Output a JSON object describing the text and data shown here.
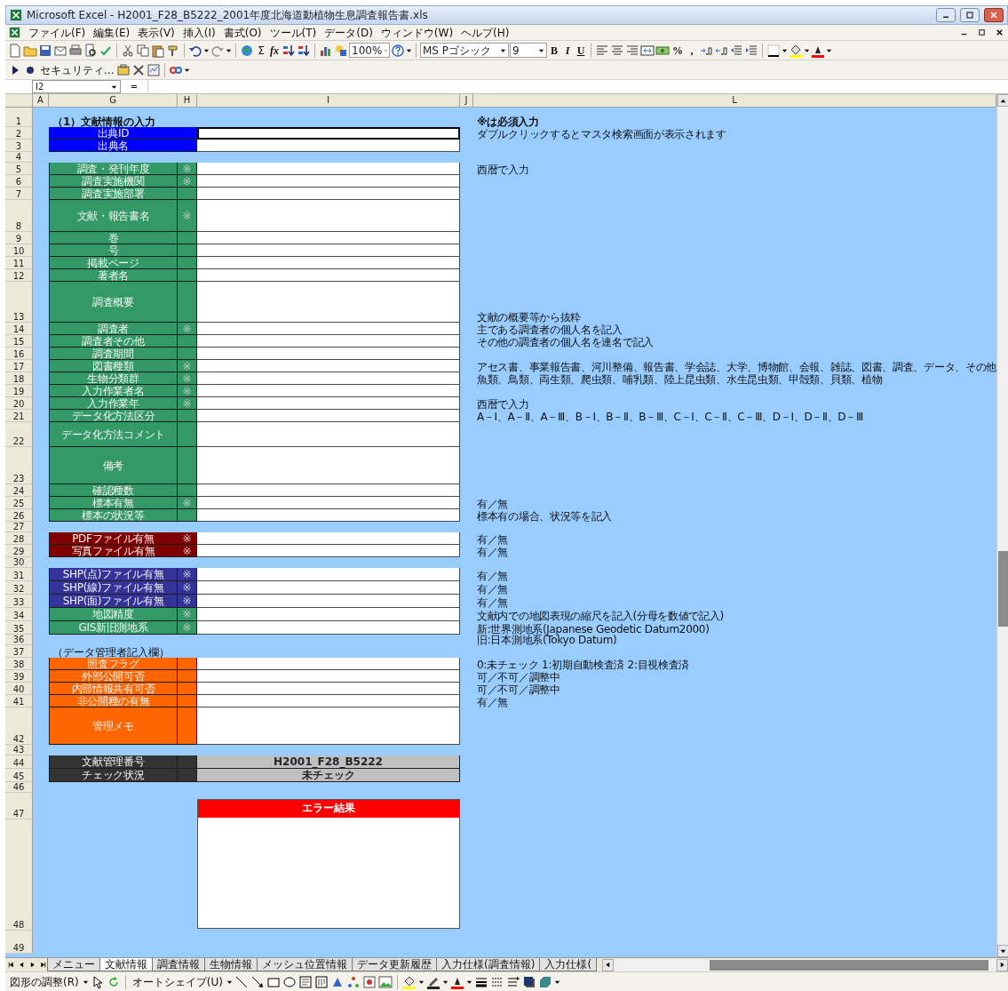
{
  "window": {
    "title": "Microsoft Excel - H2001_F28_B5222_2001年度北海道動植物生息調査報告書.xls"
  },
  "menu_bar": [
    "ファイル(F)",
    "編集(E)",
    "表示(V)",
    "挿入(I)",
    "書式(O)",
    "ツール(T)",
    "データ(D)",
    "ウィンドウ(W)",
    "ヘルプ(H)"
  ],
  "toolbar": {
    "sum": "Σ",
    "function": "fx",
    "zoom": "100%",
    "font": "MS Pゴシック",
    "font_size": "9",
    "styles": [
      "B",
      "I",
      "U"
    ],
    "percent": "%",
    "comma": ","
  },
  "toolbar_2": {
    "security": "セキュリティ..."
  },
  "formula_bar": {
    "name_box": "I2",
    "equals": "="
  },
  "column_headers": [
    "A",
    "G",
    "H",
    "I",
    "J",
    "L"
  ],
  "sheet": {
    "rows": [
      {
        "number": "1",
        "kind": "heading",
        "text": "（1）文献情報の入力",
        "note": "※は必須入力"
      },
      {
        "number": "2",
        "kind": "field",
        "label": "出典ID",
        "color": "#0000ff",
        "selected": true,
        "note": "ダブルクリックするとマスタ検索画面が表示されます"
      },
      {
        "number": "3",
        "kind": "field",
        "label": "出典名",
        "color": "#0000ff",
        "selected": false
      },
      {
        "number": "4",
        "kind": "blank"
      },
      {
        "number": "5",
        "kind": "field",
        "label": "調査・発刊年度",
        "mark": "※",
        "color": "#339966",
        "selected": false,
        "note": "西暦で入力"
      },
      {
        "number": "6",
        "kind": "field",
        "label": "調査実施機関",
        "mark": "※",
        "color": "#339966",
        "selected": false
      },
      {
        "number": "7",
        "kind": "field",
        "label": "調査実施部署",
        "color": "#339966",
        "selected": false
      },
      {
        "number": "8",
        "kind": "field",
        "label": "文献・報告書名",
        "mark": "※",
        "color": "#339966",
        "selected": false
      },
      {
        "number": "9",
        "kind": "field",
        "label": "巻",
        "color": "#339966",
        "selected": false
      },
      {
        "number": "10",
        "kind": "field",
        "label": "号",
        "color": "#339966",
        "selected": false
      },
      {
        "number": "11",
        "kind": "field",
        "label": "掲載ページ",
        "color": "#339966",
        "selected": false
      },
      {
        "number": "12",
        "kind": "field",
        "label": "著者名",
        "color": "#339966",
        "selected": false
      },
      {
        "number": "13",
        "kind": "field",
        "label": "調査概要",
        "color": "#339966",
        "selected": false,
        "note": "文献の概要等から抜粋"
      },
      {
        "number": "14",
        "kind": "field",
        "label": "調査者",
        "mark": "※",
        "color": "#339966",
        "selected": false,
        "note": "主である調査者の個人名を記入"
      },
      {
        "number": "15",
        "kind": "field",
        "label": "調査者その他",
        "color": "#339966",
        "selected": false,
        "note": "その他の調査者の個人名を連名で記入"
      },
      {
        "number": "16",
        "kind": "field",
        "label": "調査期間",
        "color": "#339966",
        "selected": false
      },
      {
        "number": "17",
        "kind": "field",
        "label": "図書種類",
        "mark": "※",
        "color": "#339966",
        "selected": false,
        "note": "アセス書、事業報告書、河川整備、報告書、学会誌、大学、博物館、会報、雑誌、図書、調査、データ、その他"
      },
      {
        "number": "18",
        "kind": "field",
        "label": "生物分類群",
        "mark": "※",
        "color": "#339966",
        "selected": false,
        "note": "魚類、鳥類、両生類、爬虫類、哺乳類、陸上昆虫類、水生昆虫類、甲殻類、貝類、植物"
      },
      {
        "number": "19",
        "kind": "field",
        "label": "入力作業者名",
        "mark": "※",
        "color": "#339966",
        "selected": false
      },
      {
        "number": "20",
        "kind": "field",
        "label": "入力作業年",
        "mark": "※",
        "color": "#339966",
        "selected": false,
        "note": "西暦で入力"
      },
      {
        "number": "21",
        "kind": "field",
        "label": "データ化方法区分",
        "color": "#339966",
        "selected": false,
        "note": "A－Ⅰ、A－Ⅱ、A－Ⅲ、B－Ⅰ、B－Ⅱ、B－Ⅲ、C－Ⅰ、C－Ⅱ、C－Ⅲ、D－Ⅰ、D－Ⅱ、D－Ⅲ"
      },
      {
        "number": "22",
        "kind": "field",
        "label": "データ化方法コメント",
        "color": "#339966",
        "selected": false
      },
      {
        "number": "23",
        "kind": "field",
        "label": "備考",
        "color": "#339966",
        "selected": false
      },
      {
        "number": "24",
        "kind": "field",
        "label": "確認種数",
        "color": "#339966",
        "selected": false
      },
      {
        "number": "25",
        "kind": "field",
        "label": "標本有無",
        "mark": "※",
        "color": "#339966",
        "selected": false,
        "note": "有／無"
      },
      {
        "number": "26",
        "kind": "field",
        "label": "標本の状況等",
        "color": "#339966",
        "selected": false,
        "note": "標本有の場合、状況等を記入"
      },
      {
        "number": "27",
        "kind": "blank"
      },
      {
        "number": "28",
        "kind": "field",
        "label": "PDFファイル有無",
        "mark": "※",
        "color": "#800000",
        "selected": false,
        "note": "有／無"
      },
      {
        "number": "29",
        "kind": "field",
        "label": "写真ファイル有無",
        "mark": "※",
        "color": "#800000",
        "selected": false,
        "note": "有／無"
      },
      {
        "number": "30",
        "kind": "blank"
      },
      {
        "number": "31",
        "kind": "field",
        "label": "SHP(点)ファイル有無",
        "mark": "※",
        "color": "#333399",
        "selected": false,
        "note": "有／無"
      },
      {
        "number": "32",
        "kind": "field",
        "label": "SHP(線)ファイル有無",
        "mark": "※",
        "color": "#333399",
        "selected": false,
        "note": "有／無"
      },
      {
        "number": "33",
        "kind": "field",
        "label": "SHP(面)ファイル有無",
        "mark": "※",
        "color": "#333399",
        "selected": false,
        "note": "有／無"
      },
      {
        "number": "34",
        "kind": "field",
        "label": "地図精度",
        "mark": "※",
        "color": "#339966",
        "selected": false,
        "note": "文献内での地図表現の縮尺を記入(分母を数値で記入)"
      },
      {
        "number": "35",
        "kind": "field",
        "label": "GIS新旧測地系",
        "mark": "※",
        "color": "#339966",
        "selected": false,
        "note": "新:世界測地系(Japanese Geodetic Datum2000)"
      },
      {
        "number": "36",
        "kind": "blank",
        "note": "旧:日本測地系(Tokyo Datum)"
      },
      {
        "number": "37",
        "kind": "section",
        "text": "（データ管理者記入欄）"
      },
      {
        "number": "38",
        "kind": "field",
        "label": "照査フラグ",
        "color": "#ff6600",
        "selected": false,
        "note": "0:未チェック 1:初期自動検査済 2:目視検査済"
      },
      {
        "number": "39",
        "kind": "field",
        "label": "外部公開可否",
        "color": "#ff6600",
        "selected": false,
        "note": "可／不可／調整中"
      },
      {
        "number": "40",
        "kind": "field",
        "label": "内部情報共有可否",
        "color": "#ff6600",
        "selected": false,
        "note": "可／不可／調整中"
      },
      {
        "number": "41",
        "kind": "field",
        "label": "非公開種の有無",
        "color": "#ff6600",
        "selected": false,
        "note": "有／無"
      },
      {
        "number": "42",
        "kind": "field",
        "label": "管理メモ",
        "color": "#ff6600",
        "selected": false
      },
      {
        "number": "43",
        "kind": "blank"
      },
      {
        "number": "44",
        "kind": "value",
        "label": "文献管理番号",
        "color": "#333333",
        "value": "H2001_F28_B5222"
      },
      {
        "number": "45",
        "kind": "value",
        "label": "チェック状況",
        "color": "#333333",
        "value": "未チェック"
      },
      {
        "number": "46",
        "kind": "blank"
      },
      {
        "number": "47",
        "kind": "error",
        "title": "エラー結果",
        "color": "#ff0000"
      },
      {
        "number": "48",
        "kind": "blank"
      },
      {
        "number": "49",
        "kind": "blank"
      }
    ]
  },
  "sheet_tabs": [
    {
      "label": "メニュー",
      "selected": false
    },
    {
      "label": "文献情報",
      "selected": true
    },
    {
      "label": "調査情報",
      "selected": false
    },
    {
      "label": "生物情報",
      "selected": false
    },
    {
      "label": "メッシュ位置情報",
      "selected": false
    },
    {
      "label": "データ更新履歴",
      "selected": false
    },
    {
      "label": "入力仕様(調査情報)",
      "selected": false
    },
    {
      "label": "入力仕様(",
      "selected": false
    }
  ],
  "drawing_toolbar": {
    "draw": "図形の調整(R)",
    "autoshapes": "オートシェイプ(U)"
  }
}
